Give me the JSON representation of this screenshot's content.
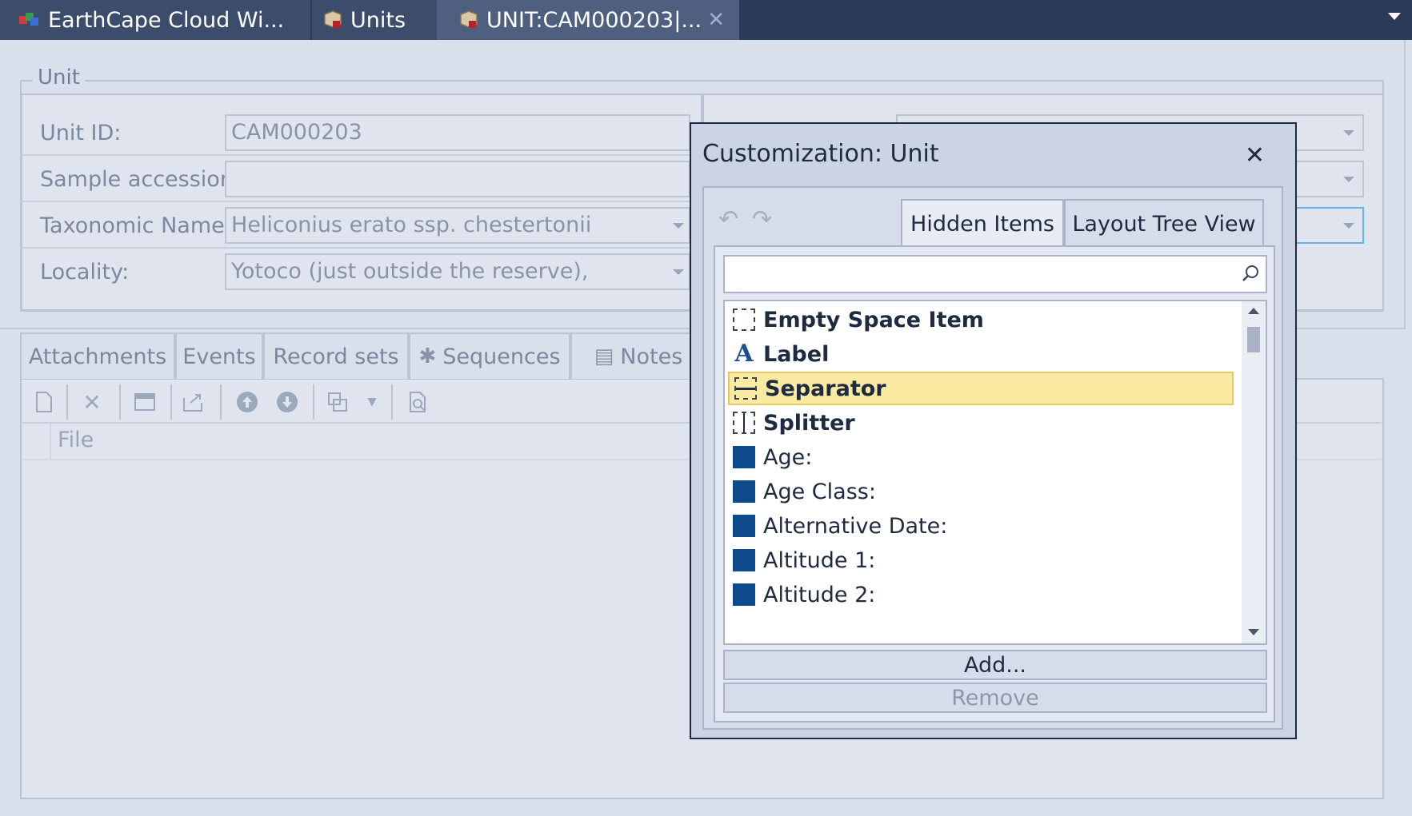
{
  "tabs": [
    {
      "label": "EarthCape Cloud Wi...",
      "icon": "app-icon"
    },
    {
      "label": "Units",
      "icon": "units-icon"
    },
    {
      "label": "UNIT:CAM000203|...",
      "icon": "unit-icon",
      "active": true
    }
  ],
  "form": {
    "group_title": "Unit",
    "fields": [
      {
        "label": "Unit ID:",
        "value": "CAM000203",
        "dropdown": false
      },
      {
        "label": "Sample accession:",
        "value": "",
        "dropdown": false
      },
      {
        "label": "Taxonomic Name:",
        "value": "Heliconius erato ssp. chestertonii",
        "dropdown": true
      },
      {
        "label": "Locality:",
        "value": "Yotoco (just outside the reserve),",
        "dropdown": true
      }
    ]
  },
  "lower_tabs": [
    "Attachments",
    "Events",
    "Record sets",
    "Sequences",
    "Notes"
  ],
  "grid": {
    "columns": [
      "File"
    ]
  },
  "dialog": {
    "title": "Customization: Unit",
    "tabs": [
      "Hidden Items",
      "Layout Tree View"
    ],
    "active_tab": "Hidden Items",
    "search_placeholder": "",
    "items": [
      {
        "label": "Empty Space Item",
        "icon": "empty-space-icon",
        "bold": true
      },
      {
        "label": "Label",
        "icon": "label-icon",
        "bold": true
      },
      {
        "label": "Separator",
        "icon": "separator-icon",
        "bold": true,
        "selected": true
      },
      {
        "label": "Splitter",
        "icon": "splitter-icon",
        "bold": true
      },
      {
        "label": "Age:",
        "icon": "field-icon"
      },
      {
        "label": "Age Class:",
        "icon": "field-icon"
      },
      {
        "label": "Alternative Date:",
        "icon": "field-icon"
      },
      {
        "label": "Altitude 1:",
        "icon": "field-icon"
      },
      {
        "label": "Altitude 2:",
        "icon": "field-icon"
      }
    ],
    "add_label": "Add...",
    "remove_label": "Remove"
  },
  "colors": {
    "titlebar": "#2b3a56",
    "selection": "#fbeaa2",
    "field_icon": "#0d4a8c"
  }
}
